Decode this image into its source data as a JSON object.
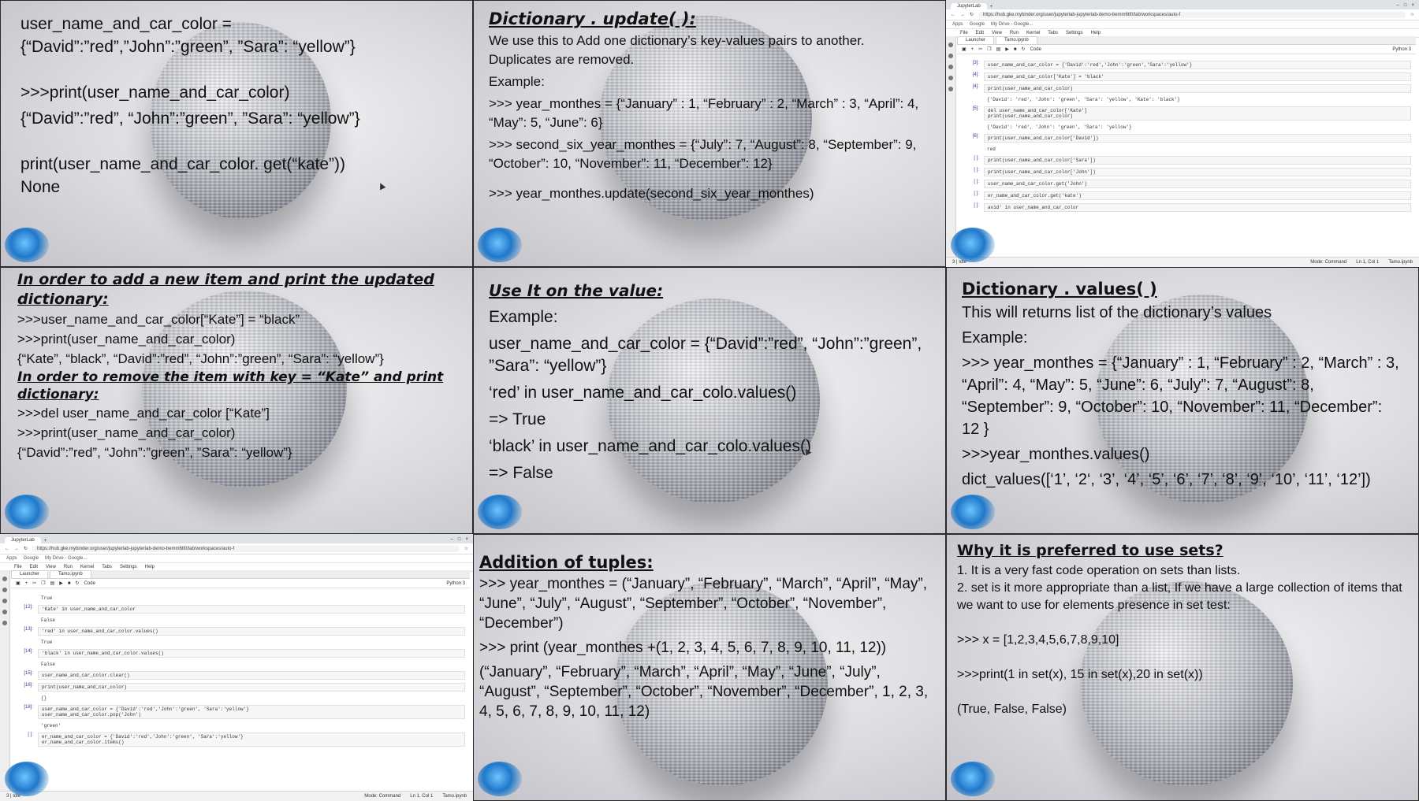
{
  "t1": {
    "lines": [
      "user_name_and_car_color =",
      "{“David”:”red”,”John”:”green”, ”Sara”: “yellow”}",
      "",
      ">>>print(user_name_and_car_color)",
      "{“David”:”red”, “John”:”green”, ”Sara”: “yellow”}",
      "",
      "print(user_name_and_car_color. get(“kate”))",
      "None"
    ]
  },
  "t2": {
    "heading": "Dictionary . update( ):",
    "lines": [
      "We use this to Add one dictionary’s key-values pairs to another. Duplicates are removed.",
      "Example:",
      ">>> year_monthes = {“January” : 1, “February” : 2, “March” : 3, “April”: 4, “May”: 5, “June”: 6}",
      ">>> second_six_year_monthes = {“July”: 7, “August”: 8, “September”: 9, “October”: 10, “November”: 11, “December”: 12}",
      "",
      ">>> year_monthes.update(second_six_year_monthes)"
    ]
  },
  "t3": {
    "browser_tab": "JupyterLab",
    "url": "https://hub.gke.mybinder.org/user/jupyterlab-jupyterlab-demo-bemm6tl0/lab/workspaces/auto-f",
    "bookmarks": [
      "Apps",
      "Google",
      "My Drive - Google..."
    ],
    "menu": [
      "File",
      "Edit",
      "View",
      "Run",
      "Kernel",
      "Tabs",
      "Settings",
      "Help"
    ],
    "nb_tabs": [
      "Launcher",
      "Tamo.ipynb"
    ],
    "kernel": "Python 3",
    "cell_type": "Code",
    "cells": [
      {
        "prompt": "[3]:",
        "code": "user_name_and_car_color = {'David':'red','John':'green','Sara':'yellow'}",
        "out": ""
      },
      {
        "prompt": "[4]:",
        "code": "user_name_and_car_color['Kate'] = 'black'",
        "out": ""
      },
      {
        "prompt": "[4]:",
        "code": "print(user_name_and_car_color)",
        "out": "{'David': 'red', 'John': 'green', 'Sara': 'yellow', 'Kate': 'black'}"
      },
      {
        "prompt": "[5]:",
        "code": "del user_name_and_car_color['Kate']\nprint(user_name_and_car_color)",
        "out": "{'David': 'red', 'John': 'green', 'Sara': 'yellow'}"
      },
      {
        "prompt": "[6]:",
        "code": "print(user_name_and_car_color['David'])",
        "out": "red"
      },
      {
        "prompt": "[ ]:",
        "code": "print(user_name_and_car_color['Sara'])",
        "out": ""
      },
      {
        "prompt": "[ ]:",
        "code": "print(user_name_and_car_color['John'])",
        "out": ""
      },
      {
        "prompt": "[ ]:",
        "code": "user_name_and_car_color.get('John')",
        "out": ""
      },
      {
        "prompt": "[ ]:",
        "code": "er_name_and_car_color.get('kate')",
        "out": ""
      },
      {
        "prompt": "[ ]:",
        "code": "avid' in user_name_and_car_color",
        "out": ""
      }
    ],
    "status_left": "3 | Idle",
    "status_mode": "Mode: Command",
    "status_pos": "Ln 1, Col 1",
    "status_file": "Tamo.ipynb"
  },
  "t4": {
    "heading1": "In order to add a new item and print the updated dictionary:",
    "lines1": [
      ">>>user_name_and_car_color[“Kate”] = “black”",
      ">>>print(user_name_and_car_color)",
      "{“Kate”, “black”, “David”:”red”, “John”:”green”, “Sara”: “yellow”}"
    ],
    "heading2": "In order to remove the item with key = “Kate” and print dictionary:",
    "lines2": [
      ">>>del user_name_and_car_color [“Kate”]",
      ">>>print(user_name_and_car_color)",
      "{“David”:”red”, “John”:”green”, ”Sara”: “yellow”}"
    ]
  },
  "t5": {
    "heading": "Use It on the value:",
    "lines": [
      "Example:",
      "user_name_and_car_color = {“David”:”red”, “John”:”green”, ”Sara”: “yellow”}",
      "‘red’ in user_name_and_car_colo.values()",
      "=> True",
      "‘black’ in user_name_and_car_colo.values()",
      "=> False"
    ]
  },
  "t6": {
    "heading": "Dictionary . values( )",
    "lines": [
      "This will returns list of the dictionary’s values",
      "Example:",
      ">>> year_monthes = {“January” : 1, “February” : 2, “March” : 3, “April”: 4, “May”: 5, “June”: 6, “July”: 7, “August”: 8, “September”: 9, “October”: 10, “November”: 11, “December”: 12 }",
      ">>>year_monthes.values()",
      "dict_values([‘1’, ‘2‘, ‘3’, ‘4’, ‘5’, ‘6’, ‘7’, ‘8’, ‘9’, ‘10’, ‘11’, ‘12’])"
    ]
  },
  "t7": {
    "browser_tab": "JupyterLab",
    "url": "https://hub.gke.mybinder.org/user/jupyterlab-jupyterlab-demo-bemm6tl0/lab/workspaces/auto-f",
    "bookmarks": [
      "Apps",
      "Google",
      "My Drive - Google..."
    ],
    "menu": [
      "File",
      "Edit",
      "View",
      "Run",
      "Kernel",
      "Tabs",
      "Settings",
      "Help"
    ],
    "nb_tabs": [
      "Launcher",
      "Tamo.ipynb"
    ],
    "kernel": "Python 3",
    "cell_type": "Code",
    "cells": [
      {
        "prompt": "",
        "code": "",
        "out": "True"
      },
      {
        "prompt": "[12]:",
        "code": "'Kate' in user_name_and_car_color",
        "out": "False"
      },
      {
        "prompt": "[13]:",
        "code": "'red' in user_name_and_car_color.values()",
        "out": "True"
      },
      {
        "prompt": "[14]:",
        "code": "'black' in user_name_and_car_color.values()",
        "out": "False"
      },
      {
        "prompt": "[15]:",
        "code": "user_name_and_car_color.clear()",
        "out": ""
      },
      {
        "prompt": "[16]:",
        "code": "print(user_name_and_car_color)",
        "out": "{}"
      },
      {
        "prompt": "[18]:",
        "code": "user_name_and_car_color = {'David':'red','John':'green', 'Sara':'yellow'}\nuser_name_and_car_color.pop('John')",
        "out": "'green'"
      },
      {
        "prompt": "[ ]:",
        "code": "er_name_and_car_color = {'David':'red','John':'green', 'Sara':'yellow'}\ner_name_and_car_color.items()",
        "out": ""
      }
    ],
    "status_left": "3 | Idle",
    "status_mode": "Mode: Command",
    "status_pos": "Ln 1, Col 1",
    "status_file": "Tamo.ipynb"
  },
  "t8": {
    "heading": "Addition of tuples:",
    "lines": [
      ">>> year_monthes = (“January”, “February”, “March”, “April”, “May”, “June”, “July”, “August”, “September”, “October”, “November”, “December”)",
      ">>> print (year_monthes +(1, 2, 3, 4, 5, 6, 7, 8, 9, 10, 11, 12))",
      "(“January”, “February”, “March”, “April”, “May”, “June”, “July”, “August”, “September”, “October”, “November”, “December”, 1, 2, 3, 4, 5, 6, 7, 8, 9, 10, 11, 12)"
    ]
  },
  "t9": {
    "heading": "Why it is preferred to use sets?",
    "lines": [
      "1. It is a very fast code operation on sets than lists.",
      "2. set is it more appropriate than a list, If we have a large collection of items that we want to use for elements presence in set test:",
      "",
      ">>> x = [1,2,3,4,5,6,7,8,9,10]",
      "",
      ">>>print(1 in set(x), 15 in set(x),20 in set(x))",
      "",
      "(True, False, False)"
    ]
  }
}
